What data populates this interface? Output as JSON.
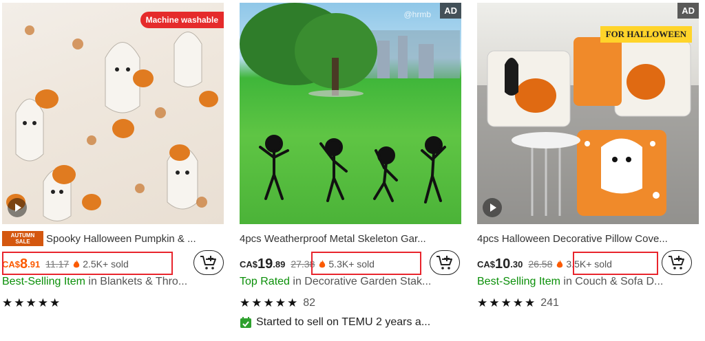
{
  "colors": {
    "price_orange": "#fb5a00",
    "best_green": "#0a8f08",
    "highlight_red": "#e8242c",
    "badge_red": "#e52b2b",
    "autumn_orange": "#d4570f"
  },
  "products": [
    {
      "image_badge": "Machine washable",
      "autumn_badge_line1": "AUTUMN",
      "autumn_badge_line2": "SALE",
      "title": "Spooky Halloween Pumpkin & ...",
      "currency": "CA$",
      "price_whole": "8",
      "price_cents": ".91",
      "old_price": "11.17",
      "sold": "2.5K+ sold",
      "category_label": "Best-Selling Item",
      "category_text": " in Blankets & Thro...",
      "stars": "★★★★★"
    },
    {
      "ad_label": "AD",
      "watermark": "@hrmb",
      "title": "4pcs Weatherproof Metal Skeleton Gar...",
      "currency": "CA$",
      "price_whole": "19",
      "price_cents": ".89",
      "old_price": "27.38",
      "sold": "5.3K+ sold",
      "category_label": "Top Rated",
      "category_text": " in Decorative Garden Stak...",
      "stars": "★★★★★",
      "review_count": "82",
      "seller_note": "Started to sell on TEMU 2 years a..."
    },
    {
      "ad_label": "AD",
      "image_badge": "FOR HALLOWEEN",
      "title": "4pcs Halloween Decorative Pillow Cove...",
      "currency": "CA$",
      "price_whole": "10",
      "price_cents": ".30",
      "old_price": "26.58",
      "sold": "3.5K+ sold",
      "category_label": "Best-Selling Item",
      "category_text": " in Couch & Sofa D...",
      "stars": "★★★★★",
      "review_count": "241"
    }
  ]
}
